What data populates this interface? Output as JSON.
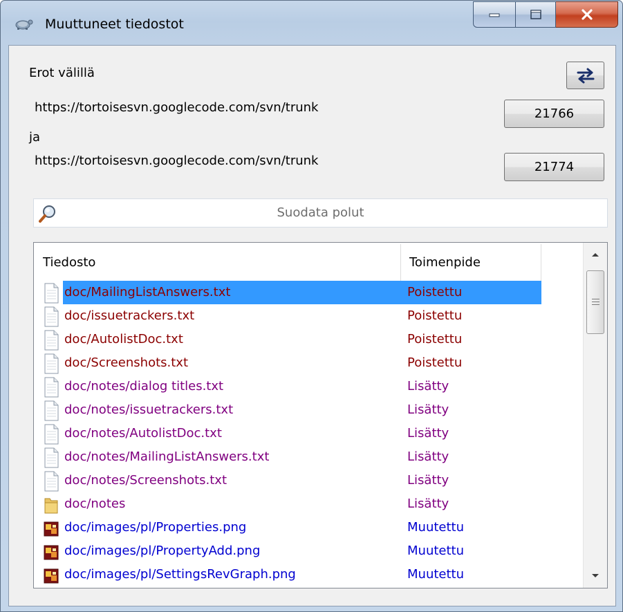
{
  "window": {
    "title": "Muuttuneet tiedostot",
    "controls": {
      "minimize": "minimize",
      "maximize": "maximize",
      "close": "close"
    }
  },
  "compare": {
    "heading": "Erot välillä",
    "url1": "https://tortoisesvn.googlecode.com/svn/trunk",
    "rev1": "21766",
    "and_label": "ja",
    "url2": "https://tortoisesvn.googlecode.com/svn/trunk",
    "rev2": "21774",
    "swap_icon": "swap-arrows-icon"
  },
  "filter": {
    "placeholder": "Suodata polut",
    "icon": "magnifier-icon"
  },
  "list": {
    "columns": [
      "Tiedosto",
      "Toimenpide"
    ],
    "rows": [
      {
        "path": "doc/MailingListAnswers.txt",
        "action": "Poistettu",
        "icon": "text-file-icon",
        "selected": true
      },
      {
        "path": "doc/issuetrackers.txt",
        "action": "Poistettu",
        "icon": "text-file-icon"
      },
      {
        "path": "doc/AutolistDoc.txt",
        "action": "Poistettu",
        "icon": "text-file-icon"
      },
      {
        "path": "doc/Screenshots.txt",
        "action": "Poistettu",
        "icon": "text-file-icon"
      },
      {
        "path": "doc/notes/dialog titles.txt",
        "action": "Lisätty",
        "icon": "text-file-icon"
      },
      {
        "path": "doc/notes/issuetrackers.txt",
        "action": "Lisätty",
        "icon": "text-file-icon"
      },
      {
        "path": "doc/notes/AutolistDoc.txt",
        "action": "Lisätty",
        "icon": "text-file-icon"
      },
      {
        "path": "doc/notes/MailingListAnswers.txt",
        "action": "Lisätty",
        "icon": "text-file-icon"
      },
      {
        "path": "doc/notes/Screenshots.txt",
        "action": "Lisätty",
        "icon": "text-file-icon"
      },
      {
        "path": "doc/notes",
        "action": "Lisätty",
        "icon": "folder-icon"
      },
      {
        "path": "doc/images/pl/Properties.png",
        "action": "Muutettu",
        "icon": "image-file-icon"
      },
      {
        "path": "doc/images/pl/PropertyAdd.png",
        "action": "Muutettu",
        "icon": "image-file-icon"
      },
      {
        "path": "doc/images/pl/SettingsRevGraph.png",
        "action": "Muutettu",
        "icon": "image-file-icon"
      }
    ]
  },
  "colors": {
    "deleted": "#8b0000",
    "added": "#800080",
    "modified": "#0000d0",
    "selection": "#3399ff"
  }
}
